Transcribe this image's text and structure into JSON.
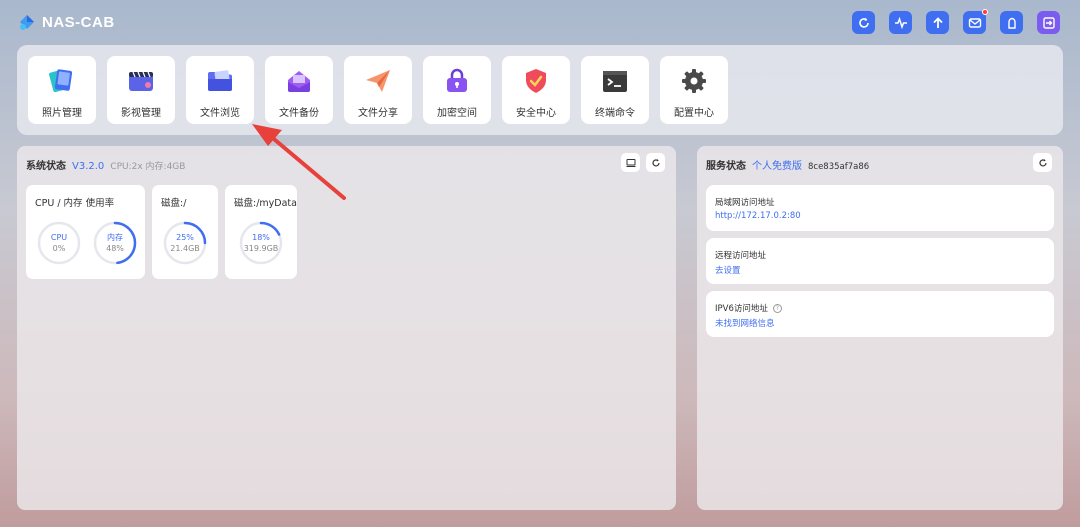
{
  "header": {
    "app_name": "NAS-CAB",
    "actions": [
      {
        "name": "refresh-icon"
      },
      {
        "name": "activity-icon"
      },
      {
        "name": "upload-icon"
      },
      {
        "name": "mail-icon",
        "notification": true
      },
      {
        "name": "user-icon"
      },
      {
        "name": "logout-icon"
      }
    ]
  },
  "apps": [
    {
      "label": "照片管理",
      "icon": "photos-icon"
    },
    {
      "label": "影视管理",
      "icon": "video-icon"
    },
    {
      "label": "文件浏览",
      "icon": "folder-icon"
    },
    {
      "label": "文件备份",
      "icon": "backup-icon"
    },
    {
      "label": "文件分享",
      "icon": "share-icon"
    },
    {
      "label": "加密空间",
      "icon": "lock-icon"
    },
    {
      "label": "安全中心",
      "icon": "shield-icon"
    },
    {
      "label": "终端命令",
      "icon": "terminal-icon"
    },
    {
      "label": "配置中心",
      "icon": "gear-icon"
    }
  ],
  "system": {
    "title": "系统状态",
    "version": "V3.2.0",
    "specs": "CPU:2x 内存:4GB",
    "cards": [
      {
        "title": "CPU / 内存 使用率",
        "gauges": [
          {
            "name": "CPU",
            "value": "0%",
            "percent": 0
          },
          {
            "name": "内存",
            "value": "48%",
            "percent": 48
          }
        ]
      },
      {
        "title": "磁盘:/",
        "gauges": [
          {
            "name": "25%",
            "value": "21.4GB",
            "percent": 25
          }
        ]
      },
      {
        "title": "磁盘:/myData",
        "gauges": [
          {
            "name": "18%",
            "value": "319.9GB",
            "percent": 18
          }
        ]
      }
    ]
  },
  "service": {
    "title": "服务状态",
    "plan": "个人免费版",
    "id": "8ce835af7a86",
    "rows": [
      {
        "label": "局域网访问地址",
        "value": "http://172.17.0.2:80"
      },
      {
        "label": "远程访问地址",
        "value": "去设置"
      },
      {
        "label": "IPV6访问地址",
        "value": "未找到网络信息",
        "help": "?"
      }
    ]
  },
  "colors": {
    "accent": "#3f6ef0",
    "track": "#e5e7ec",
    "arrow": "#e8403a"
  }
}
